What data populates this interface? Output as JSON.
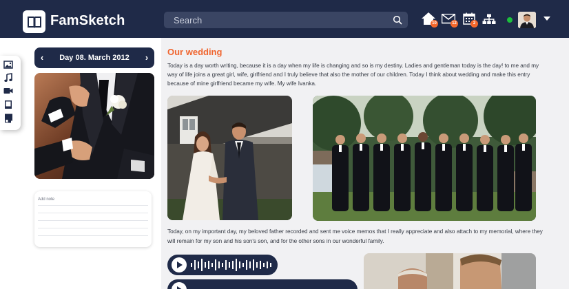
{
  "app": {
    "name": "FamSketch"
  },
  "search": {
    "placeholder": "Search"
  },
  "nav": {
    "badges": {
      "home": "10",
      "mail": "12",
      "calendar": "2"
    }
  },
  "date_nav": {
    "label": "Day 08. March 2012",
    "prev_symbol": "‹",
    "next_symbol": "›"
  },
  "note": {
    "label": "Add note"
  },
  "entry": {
    "title": "Our wedding",
    "paragraph1": "Today is a day worth writing, because it is a day when my life is changing and so is my destiny. Ladies and gentleman today is the day! to me and my way of life joins a great girl, wife, girlfriend and I truly believe that also the mother of our children. Today I think about wedding and make this entry because of mine girlfriend became my wife. My wife Ivanka.",
    "paragraph2": "Today, on my important day, my beloved father recorded and sent me voice memos that I really appreciate and also attach to my memorial, where they will remain for my son and his son's son, and for the other sons in our wonderful family."
  },
  "colors": {
    "header_bg": "#1f2a48",
    "accent": "#f0652f",
    "badge": "#f4682c",
    "online": "#1bbf3c",
    "main_bg": "#f1f1f3"
  },
  "icons": [
    "book-logo-icon",
    "search-icon",
    "home-icon",
    "mail-icon",
    "calendar-icon",
    "family-tree-icon",
    "chevron-down-icon",
    "image-icon",
    "music-icon",
    "video-icon",
    "notebook-icon",
    "bookmark-icon",
    "play-icon"
  ]
}
